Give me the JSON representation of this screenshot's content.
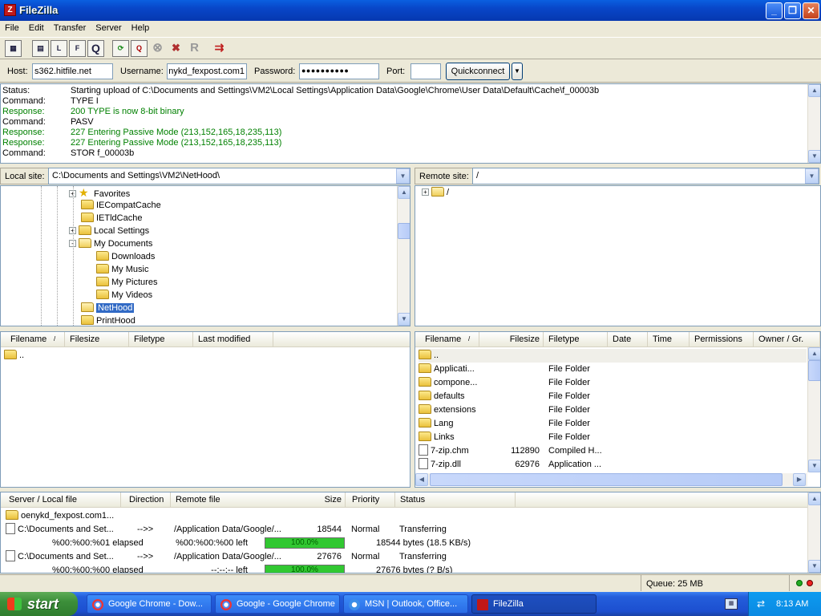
{
  "window": {
    "title": "FileZilla",
    "icon": "filezilla-icon"
  },
  "menu": [
    "File",
    "Edit",
    "Transfer",
    "Server",
    "Help"
  ],
  "quickconnect": {
    "host_label": "Host:",
    "host_value": "s362.hitfile.net",
    "user_label": "Username:",
    "user_value": "nykd_fexpost.com1",
    "pass_label": "Password:",
    "pass_value": "●●●●●●●●●●",
    "port_label": "Port:",
    "port_value": "",
    "button": "Quickconnect"
  },
  "log": [
    {
      "type": "Status:",
      "text": "Starting upload of C:\\Documents and Settings\\VM2\\Local Settings\\Application Data\\Google\\Chrome\\User Data\\Default\\Cache\\f_00003b",
      "kind": "status"
    },
    {
      "type": "Command:",
      "text": "TYPE I",
      "kind": "command"
    },
    {
      "type": "Response:",
      "text": "200 TYPE is now 8-bit binary",
      "kind": "response"
    },
    {
      "type": "Command:",
      "text": "PASV",
      "kind": "command"
    },
    {
      "type": "Response:",
      "text": "227 Entering Passive Mode (213,152,165,18,235,113)",
      "kind": "response"
    },
    {
      "type": "Response:",
      "text": "227 Entering Passive Mode (213,152,165,18,235,113)",
      "kind": "response"
    },
    {
      "type": "Command:",
      "text": "STOR f_00003b",
      "kind": "command"
    }
  ],
  "local": {
    "label": "Local site:",
    "path": "C:\\Documents and Settings\\VM2\\NetHood\\",
    "tree": [
      {
        "label": "Favorites",
        "level": 0,
        "expander": "+",
        "icon": "star-icon"
      },
      {
        "label": "IECompatCache",
        "level": 0,
        "expander": "",
        "icon": "folder-icon"
      },
      {
        "label": "IETldCache",
        "level": 0,
        "expander": "",
        "icon": "folder-icon"
      },
      {
        "label": "Local Settings",
        "level": 0,
        "expander": "+",
        "icon": "folder-icon"
      },
      {
        "label": "My Documents",
        "level": 0,
        "expander": "-",
        "icon": "folder-open-icon"
      },
      {
        "label": "Downloads",
        "level": 1,
        "expander": "",
        "icon": "folder-icon"
      },
      {
        "label": "My Music",
        "level": 1,
        "expander": "",
        "icon": "music-folder-icon"
      },
      {
        "label": "My Pictures",
        "level": 1,
        "expander": "",
        "icon": "pictures-folder-icon"
      },
      {
        "label": "My Videos",
        "level": 1,
        "expander": "",
        "icon": "videos-folder-icon"
      },
      {
        "label": "NetHood",
        "level": 0,
        "expander": "",
        "icon": "folder-open-icon",
        "selected": true
      },
      {
        "label": "PrintHood",
        "level": 0,
        "expander": "",
        "icon": "folder-icon"
      }
    ],
    "columns": [
      "Filename",
      "Filesize",
      "Filetype",
      "Last modified"
    ],
    "files": [
      {
        "name": ".."
      }
    ]
  },
  "remote": {
    "label": "Remote site:",
    "path": "/",
    "tree": [
      {
        "label": "/",
        "expander": "+"
      }
    ],
    "columns": [
      "Filename",
      "Filesize",
      "Filetype",
      "Date",
      "Time",
      "Permissions",
      "Owner / Gr."
    ],
    "files": [
      {
        "name": "..",
        "size": "",
        "type": "",
        "icon": "folder-icon"
      },
      {
        "name": "Applicati...",
        "size": "",
        "type": "File Folder",
        "icon": "folder-icon"
      },
      {
        "name": "compone...",
        "size": "",
        "type": "File Folder",
        "icon": "folder-icon"
      },
      {
        "name": "defaults",
        "size": "",
        "type": "File Folder",
        "icon": "folder-icon"
      },
      {
        "name": "extensions",
        "size": "",
        "type": "File Folder",
        "icon": "folder-icon"
      },
      {
        "name": "Lang",
        "size": "",
        "type": "File Folder",
        "icon": "folder-icon"
      },
      {
        "name": "Links",
        "size": "",
        "type": "File Folder",
        "icon": "folder-icon"
      },
      {
        "name": "7-zip.chm",
        "size": "112890",
        "type": "Compiled H...",
        "icon": "help-file-icon"
      },
      {
        "name": "7-zip.dll",
        "size": "62976",
        "type": "Application ...",
        "icon": "dll-file-icon"
      }
    ]
  },
  "queue": {
    "columns": [
      "Server / Local file",
      "Direction",
      "Remote file",
      "Size",
      "Priority",
      "Status"
    ],
    "server": "oenykd_fexpost.com1...",
    "items": [
      {
        "local": "C:\\Documents and Set...",
        "direction": "-->>",
        "remote": "/Application Data/Google/...",
        "size": "18544",
        "priority": "Normal",
        "status": "Transferring",
        "elapsed": "%00:%00:%01 elapsed",
        "left": "%00:%00:%00 left",
        "progress": 100,
        "progress_text": "100.0%",
        "bytes": "18544 bytes (18.5 KB/s)"
      },
      {
        "local": "C:\\Documents and Set...",
        "direction": "-->>",
        "remote": "/Application Data/Google/...",
        "size": "27676",
        "priority": "Normal",
        "status": "Transferring",
        "elapsed": "%00:%00:%00 elapsed",
        "left": "--:--:-- left",
        "progress": 100,
        "progress_text": "100.0%",
        "bytes": "27676 bytes (? B/s)"
      }
    ]
  },
  "status": {
    "queue": "Queue: 25 MB"
  },
  "taskbar": {
    "start": "start",
    "tasks": [
      {
        "label": "Google Chrome - Dow...",
        "icon": "chrome-icon"
      },
      {
        "label": "Google - Google Chrome",
        "icon": "chrome-icon"
      },
      {
        "label": "MSN | Outlook, Office...",
        "icon": "ie-icon"
      },
      {
        "label": "FileZilla",
        "icon": "filezilla-icon",
        "active": true
      }
    ],
    "clock": "8:13 AM"
  }
}
